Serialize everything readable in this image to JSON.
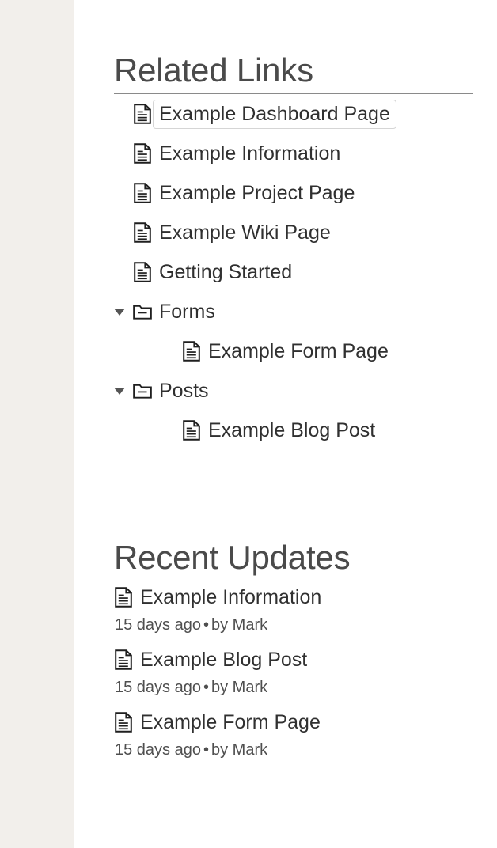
{
  "colors": {
    "rail_background": "#f2efeb",
    "rail_border": "#dcdcdc",
    "page_background": "#ffffff",
    "heading_text": "#4a4a4a",
    "heading_rule": "#8a8a8a",
    "link_text": "#303030",
    "meta_text": "#4f4f4f",
    "selection_border": "#d5d5d5",
    "icon_stroke": "#1f1f1f",
    "twisty_fill": "#555555"
  },
  "related_links": {
    "heading": "Related Links",
    "items": [
      {
        "label": "Example Dashboard Page",
        "icon": "document-icon",
        "type": "page",
        "depth": 0,
        "selected": true,
        "expanded": null
      },
      {
        "label": "Example Information",
        "icon": "document-icon",
        "type": "page",
        "depth": 0,
        "selected": false,
        "expanded": null
      },
      {
        "label": "Example Project Page",
        "icon": "document-icon",
        "type": "page",
        "depth": 0,
        "selected": false,
        "expanded": null
      },
      {
        "label": "Example Wiki Page",
        "icon": "document-icon",
        "type": "page",
        "depth": 0,
        "selected": false,
        "expanded": null
      },
      {
        "label": "Getting Started",
        "icon": "document-icon",
        "type": "page",
        "depth": 0,
        "selected": false,
        "expanded": null
      },
      {
        "label": "Forms",
        "icon": "folder-icon",
        "type": "folder",
        "depth": 0,
        "selected": false,
        "expanded": true,
        "twisty": "chevron-down-icon"
      },
      {
        "label": "Example Form Page",
        "icon": "document-icon",
        "type": "page",
        "depth": 1,
        "selected": false,
        "expanded": null
      },
      {
        "label": "Posts",
        "icon": "folder-icon",
        "type": "folder",
        "depth": 0,
        "selected": false,
        "expanded": true,
        "twisty": "chevron-down-icon"
      },
      {
        "label": "Example Blog Post",
        "icon": "document-icon",
        "type": "page",
        "depth": 1,
        "selected": false,
        "expanded": null
      }
    ]
  },
  "recent_updates": {
    "heading": "Recent Updates",
    "items": [
      {
        "title": "Example Information",
        "icon": "document-icon",
        "time": "15 days ago",
        "separator": "•",
        "author": "by Mark"
      },
      {
        "title": "Example Blog Post",
        "icon": "document-icon",
        "time": "15 days ago",
        "separator": "•",
        "author": "by Mark"
      },
      {
        "title": "Example Form Page",
        "icon": "document-icon",
        "time": "15 days ago",
        "separator": "•",
        "author": "by Mark"
      }
    ]
  }
}
